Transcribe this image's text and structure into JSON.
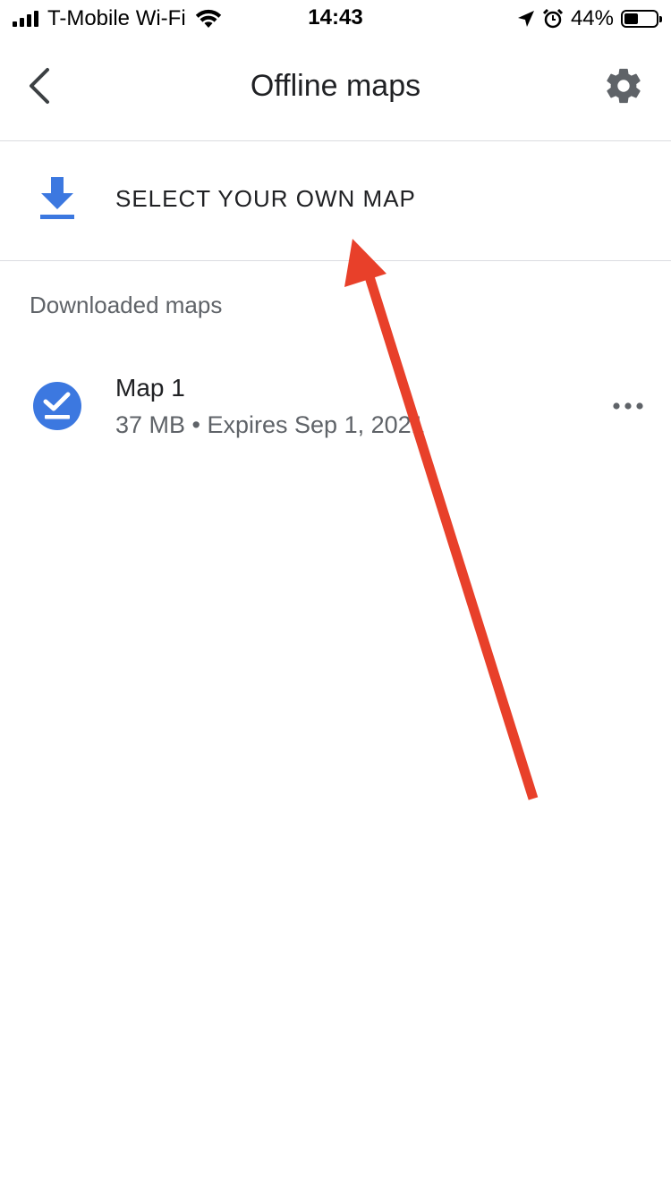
{
  "status_bar": {
    "carrier": "T-Mobile Wi-Fi",
    "time": "14:43",
    "battery": "44%",
    "battery_level": 0.44,
    "icons": [
      "signal-icon",
      "wifi-icon",
      "location-icon",
      "alarm-icon",
      "battery-icon"
    ]
  },
  "header": {
    "title": "Offline maps",
    "back_icon": "chevron-left-icon",
    "settings_icon": "gear-icon"
  },
  "select_map": {
    "label": "SELECT YOUR OWN MAP",
    "icon": "download-icon"
  },
  "downloaded": {
    "section_title": "Downloaded maps",
    "items": [
      {
        "name": "Map 1",
        "meta": "37 MB • Expires Sep 1, 2021",
        "icon": "downloaded-check-icon",
        "menu_icon": "more-horizontal-icon"
      }
    ]
  },
  "colors": {
    "accent": "#3c78e0",
    "annotation": "#e8402a",
    "divider": "#dadce0",
    "secondary_text": "#5f6368"
  }
}
